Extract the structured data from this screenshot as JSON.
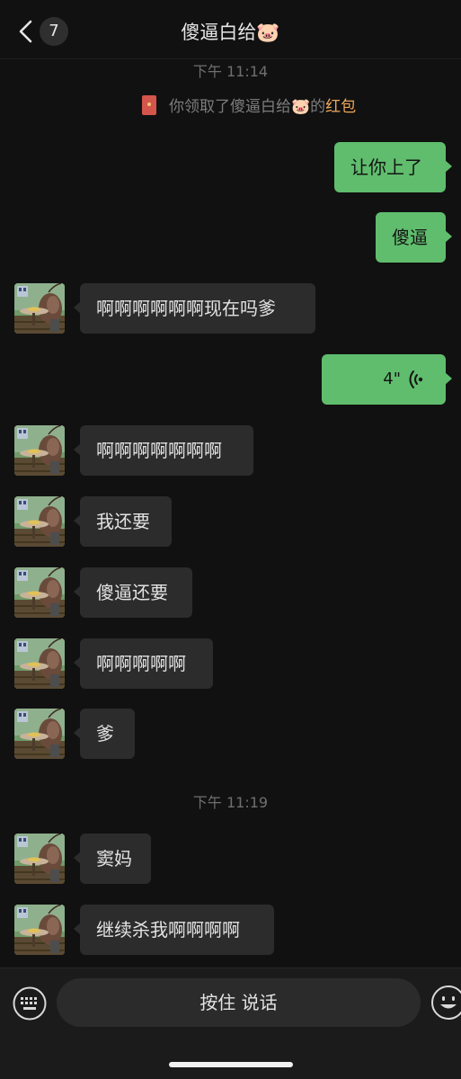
{
  "header": {
    "back_label": "<",
    "unread_count": "7",
    "title": "傻逼白给🐷"
  },
  "times": [
    "下午 11:14",
    "下午 11:19"
  ],
  "system_message": {
    "prefix": "你领取了傻逼白给🐷的",
    "highlight": "红包"
  },
  "messages": [
    {
      "side": "right",
      "text": "让你上了"
    },
    {
      "side": "right",
      "text": "傻逼"
    },
    {
      "side": "left",
      "text": "啊啊啊啊啊啊现在吗爹"
    },
    {
      "side": "right",
      "type": "voice",
      "duration": "4\""
    },
    {
      "side": "left",
      "text": "啊啊啊啊啊啊啊"
    },
    {
      "side": "left",
      "text": "我还要"
    },
    {
      "side": "left",
      "text": "傻逼还要"
    },
    {
      "side": "left",
      "text": "啊啊啊啊啊"
    },
    {
      "side": "left",
      "text": "爹"
    },
    {
      "side": "left",
      "text": "窦妈"
    },
    {
      "side": "left",
      "text": "继续杀我啊啊啊啊"
    }
  ],
  "input": {
    "talk_label": "按住 说话",
    "keyboard_icon": "keyboard-icon",
    "emoji_icon": "emoji-icon"
  },
  "colors": {
    "background": "#111111",
    "incoming_bubble": "#2c2c2c",
    "outgoing_bubble": "#5fbd6d",
    "red_packet_highlight": "#f0a95a"
  }
}
